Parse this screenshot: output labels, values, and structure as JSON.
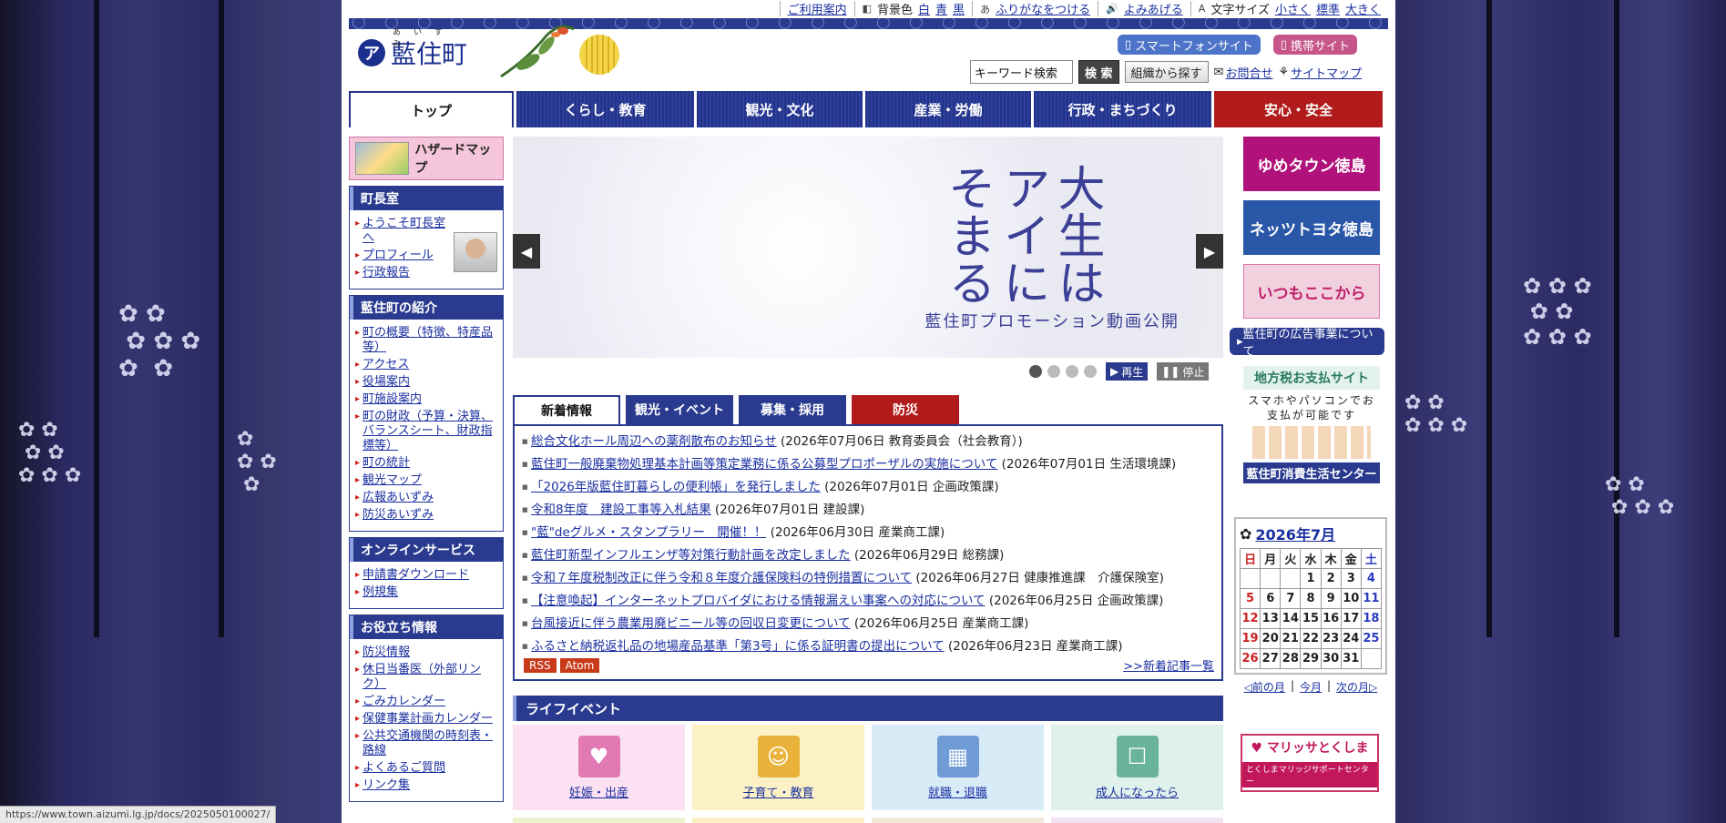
{
  "util": {
    "usage": "ご利用案内",
    "bgcolor_label": "背景色",
    "bg_white": "白",
    "bg_blue": "青",
    "bg_black": "黒",
    "furigana": "ふりがなをつける",
    "readaloud": "よみあげる",
    "fontsize_label": "文字サイズ",
    "small": "小さく",
    "standard": "標準",
    "large": "大きく"
  },
  "header": {
    "town_name": "藍住町",
    "ruby": "あいずみ",
    "smartphone": "スマートフォンサイト",
    "mobile": "携帯サイト",
    "search_value": "キーワード検索",
    "search_button": "検 索",
    "org_button": "組織から探す",
    "contact": "お問合せ",
    "sitemap": "サイトマップ"
  },
  "nav": {
    "tabs": [
      "トップ",
      "くらし・教育",
      "観光・文化",
      "産業・労働",
      "行政・まちづくり",
      "安心・安全"
    ]
  },
  "left": {
    "hazard": "ハザードマップ",
    "mayor_title": "町長室",
    "mayor_links": [
      "ようこそ町長室へ",
      "プロフィール",
      "行政報告"
    ],
    "intro_title": "藍住町の紹介",
    "intro_links": [
      "町の概要（特徴、特産品等）",
      "アクセス",
      "役場案内",
      "町施設案内",
      "町の財政（予算・決算、バランスシート、財政指標等）",
      "町の統計",
      "観光マップ",
      "広報あいずみ",
      "防災あいずみ"
    ],
    "online_title": "オンラインサービス",
    "online_links": [
      "申請書ダウンロード",
      "例規集"
    ],
    "useful_title": "お役立ち情報",
    "useful_links": [
      "防災情報",
      "休日当番医（外部リンク）",
      "ごみカレンダー",
      "保健事業計画カレンダー",
      "公共交通機関の時刻表・路線",
      "よくあるご質問",
      "リンク集"
    ]
  },
  "slider": {
    "vertical_text": [
      "大生は",
      "アイに",
      "そまる"
    ],
    "caption": "藍住町プロモーション動画公開",
    "play": "再生",
    "stop": "停止",
    "dots": 4,
    "active_dot": 1
  },
  "news": {
    "tabs": [
      "新着情報",
      "観光・イベント",
      "募集・採用",
      "防災"
    ],
    "items": [
      {
        "link": "総合文化ホール周辺への薬剤散布のお知らせ",
        "meta": "(2026年07月06日 教育委員会（社会教育）)"
      },
      {
        "link": "藍住町一般廃棄物処理基本計画等策定業務に係る公募型プロポーザルの実施について",
        "meta": "(2026年07月01日 生活環境課)"
      },
      {
        "link": "「2026年版藍住町暮らしの便利帳」を発行しました",
        "meta": "(2026年07月01日 企画政策課)"
      },
      {
        "link": "令和8年度　建設工事等入札結果",
        "meta": "(2026年07月01日 建設課)"
      },
      {
        "link": "\"藍\"deグルメ・スタンプラリー　開催！！",
        "meta": "(2026年06月30日 産業商工課)"
      },
      {
        "link": "藍住町新型インフルエンザ等対策行動計画を改定しました",
        "meta": "(2026年06月29日 総務課)"
      },
      {
        "link": "令和７年度税制改正に伴う令和８年度介護保険料の特例措置について",
        "meta": "(2026年06月27日 健康推進課　介護保険室)"
      },
      {
        "link": "【注意喚起】インターネットプロバイダにおける情報漏えい事案への対応について",
        "meta": "(2026年06月25日 企画政策課)"
      },
      {
        "link": "台風接近に伴う農業用廃ビニール等の回収日変更について",
        "meta": "(2026年06月25日 産業商工課)"
      },
      {
        "link": "ふるさと納税返礼品の地場産品基準「第3号」に係る証明書の提出について",
        "meta": "(2026年06月23日 産業商工課)"
      }
    ],
    "rss": "RSS",
    "atom": "Atom",
    "more": ">>新着記事一覧"
  },
  "life": {
    "title": "ライフイベント",
    "cards": [
      {
        "label": "妊娠・出産",
        "bg": "#fbe1f1",
        "icon_bg": "#e17ab3",
        "icon": "person-heart-icon"
      },
      {
        "label": "子育て・教育",
        "bg": "#fbf1c4",
        "icon_bg": "#e9b23a",
        "icon": "family-icon"
      },
      {
        "label": "就職・退職",
        "bg": "#d8ecf8",
        "icon_bg": "#6f9bd6",
        "icon": "building-person-icon"
      },
      {
        "label": "成人になったら",
        "bg": "#dff1ea",
        "icon_bg": "#69b39c",
        "icon": "ballot-box-icon"
      }
    ]
  },
  "right": {
    "banners": [
      {
        "label": "ゆめタウン徳島",
        "color": "#b0117a"
      },
      {
        "label": "ネッツトヨタ徳島",
        "color": "#2a57a8"
      },
      {
        "label": "いつもここから",
        "color": "#f2d1df"
      }
    ],
    "ad_link": "藍住町の広告事業について",
    "tax_title": "地方税お支払サイト",
    "tax_text": "スマホやパソコンでお支払が可能です",
    "consumer_center": "藍住町消費生活センター"
  },
  "calendar": {
    "title": "2026年7月",
    "weekdays": [
      "日",
      "月",
      "火",
      "水",
      "木",
      "金",
      "土"
    ],
    "weeks": [
      [
        "",
        "",
        "",
        "1",
        "2",
        "3",
        "4"
      ],
      [
        "5",
        "6",
        "7",
        "8",
        "9",
        "10",
        "11"
      ],
      [
        "12",
        "13",
        "14",
        "15",
        "16",
        "17",
        "18"
      ],
      [
        "19",
        "20",
        "21",
        "22",
        "23",
        "24",
        "25"
      ],
      [
        "26",
        "27",
        "28",
        "29",
        "30",
        "31",
        ""
      ]
    ],
    "prev": "◁前の月",
    "current": "今月",
    "next": "次の月▷"
  },
  "marry": {
    "title": "マリッサとくしま",
    "sub": "とくしまマリッジサポートセンター"
  },
  "status_url": "https://www.town.aizumi.lg.jp/docs/2025050100027/"
}
